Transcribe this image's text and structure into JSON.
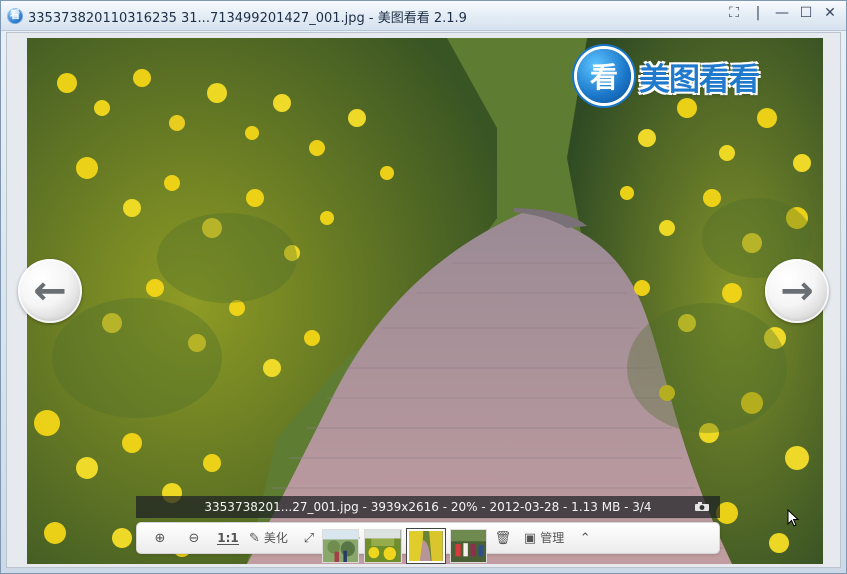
{
  "window": {
    "title": "335373820110316235 31...713499201427_001.jpg - 美图看看 2.1.9",
    "icon_text": "看"
  },
  "titlebar": {
    "controls": [
      {
        "name": "fit-window-icon",
        "glyph": "⛶"
      },
      {
        "name": "separator-icon",
        "glyph": "|"
      },
      {
        "name": "minimize-icon",
        "glyph": "—"
      },
      {
        "name": "maximize-icon",
        "glyph": "☐"
      },
      {
        "name": "close-icon",
        "glyph": "✕"
      }
    ]
  },
  "brand": {
    "badge_text": "看",
    "name": "美图看看"
  },
  "navigation": {
    "prev_glyph": "←",
    "next_glyph": "→"
  },
  "image_info": {
    "text": "3353738201...27_001.jpg - 3939x2616 - 20% - 2012-03-28 - 1.13 MB - 3/4"
  },
  "toolbar": {
    "zoom_in_glyph": "⊕",
    "zoom_out_glyph": "⊖",
    "actual_size_label": "1:1",
    "beautify_label": "美化",
    "fullscreen_glyph": "⤢",
    "prev_glyph": "←",
    "next_glyph": "→",
    "rotate_left_glyph": "↺",
    "rotate_right_glyph": "↻",
    "delete_glyph": "🗑",
    "manage_label": "管理",
    "collapse_glyph": "⌃"
  },
  "thumbnails": [
    {
      "name": "thumbnail-1",
      "active": false
    },
    {
      "name": "thumbnail-2",
      "active": false
    },
    {
      "name": "thumbnail-3",
      "active": true
    },
    {
      "name": "thumbnail-4",
      "active": false
    }
  ],
  "colors": {
    "brand_blue": "#1f79cc",
    "flower_yellow": "#f3d617",
    "path_pink": "#b08f93"
  }
}
